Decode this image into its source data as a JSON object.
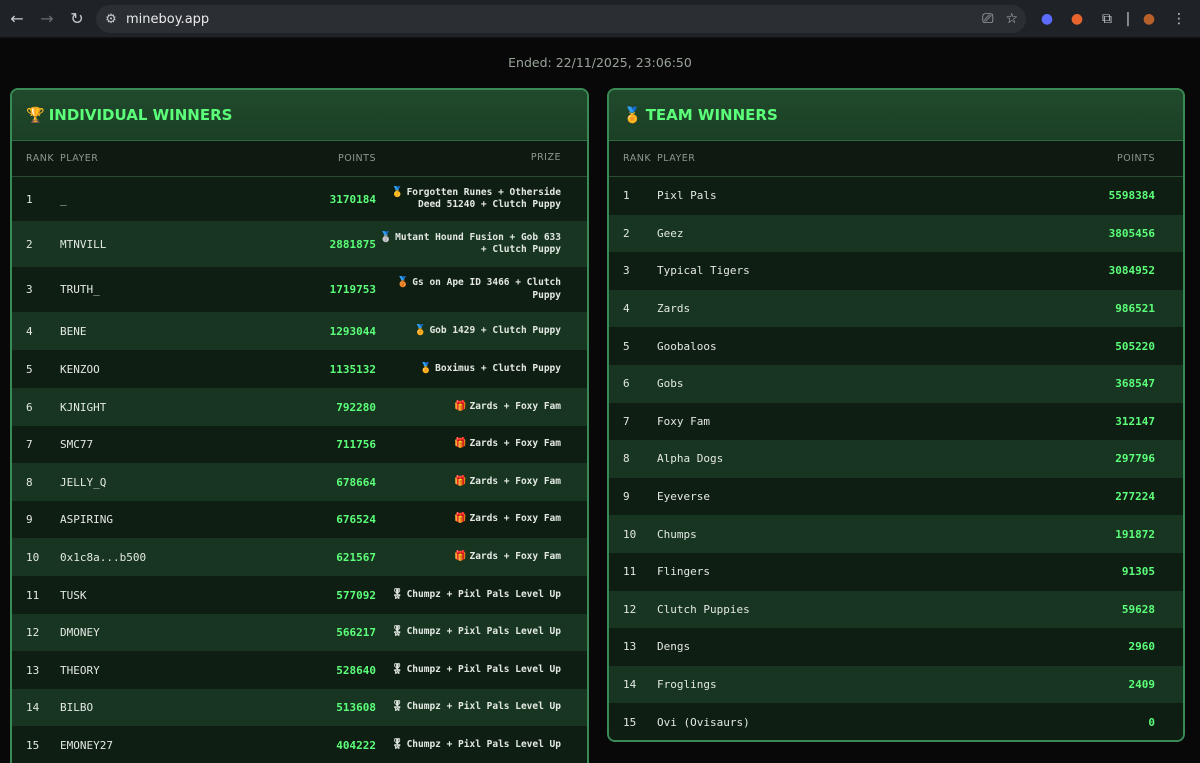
{
  "browser": {
    "url": "mineboy.app"
  },
  "ended_text": "Ended: 22/11/2025, 23:06:50",
  "individual": {
    "title": "INDIVIDUAL WINNERS",
    "title_icon": "🏆",
    "headers": {
      "rank": "RANK",
      "player": "PLAYER",
      "points": "POINTS",
      "prize": "PRIZE"
    },
    "rows": [
      {
        "rank": "1",
        "player": "_",
        "points": "3170184",
        "prize_icon": "🥇",
        "prize": "Forgotten Runes + Otherside Deed 51240 + Clutch Puppy"
      },
      {
        "rank": "2",
        "player": "MTNVILL",
        "points": "2881875",
        "prize_icon": "🥈",
        "prize": "Mutant Hound Fusion + Gob 633 + Clutch Puppy"
      },
      {
        "rank": "3",
        "player": "TRUTH_",
        "points": "1719753",
        "prize_icon": "🥉",
        "prize": "Gs on Ape ID 3466 + Clutch Puppy"
      },
      {
        "rank": "4",
        "player": "BENE",
        "points": "1293044",
        "prize_icon": "🏅",
        "prize": "Gob 1429 + Clutch Puppy"
      },
      {
        "rank": "5",
        "player": "KENZOO",
        "points": "1135132",
        "prize_icon": "🏅",
        "prize": "Boximus + Clutch Puppy"
      },
      {
        "rank": "6",
        "player": "KJNIGHT",
        "points": "792280",
        "prize_icon": "🎁",
        "prize": "Zards + Foxy Fam"
      },
      {
        "rank": "7",
        "player": "SMC77",
        "points": "711756",
        "prize_icon": "🎁",
        "prize": "Zards + Foxy Fam"
      },
      {
        "rank": "8",
        "player": "JELLY_Q",
        "points": "678664",
        "prize_icon": "🎁",
        "prize": "Zards + Foxy Fam"
      },
      {
        "rank": "9",
        "player": "ASPIRING",
        "points": "676524",
        "prize_icon": "🎁",
        "prize": "Zards + Foxy Fam"
      },
      {
        "rank": "10",
        "player": "0x1c8a...b500",
        "points": "621567",
        "prize_icon": "🎁",
        "prize": "Zards + Foxy Fam"
      },
      {
        "rank": "11",
        "player": "TUSK",
        "points": "577092",
        "prize_icon": "🎖",
        "prize": "Chumpz + Pixl Pals Level Up"
      },
      {
        "rank": "12",
        "player": "DMONEY",
        "points": "566217",
        "prize_icon": "🎖",
        "prize": "Chumpz + Pixl Pals Level Up"
      },
      {
        "rank": "13",
        "player": "THEORY",
        "points": "528640",
        "prize_icon": "🎖",
        "prize": "Chumpz + Pixl Pals Level Up"
      },
      {
        "rank": "14",
        "player": "BILBO",
        "points": "513608",
        "prize_icon": "🎖",
        "prize": "Chumpz + Pixl Pals Level Up"
      },
      {
        "rank": "15",
        "player": "EMONEY27",
        "points": "404222",
        "prize_icon": "🎖",
        "prize": "Chumpz + Pixl Pals Level Up"
      }
    ]
  },
  "team": {
    "title": "TEAM WINNERS",
    "title_icon": "🏅",
    "headers": {
      "rank": "RANK",
      "player": "PLAYER",
      "points": "POINTS"
    },
    "rows": [
      {
        "rank": "1",
        "player": "Pixl Pals",
        "points": "5598384"
      },
      {
        "rank": "2",
        "player": "Geez",
        "points": "3805456"
      },
      {
        "rank": "3",
        "player": "Typical Tigers",
        "points": "3084952"
      },
      {
        "rank": "4",
        "player": "Zards",
        "points": "986521"
      },
      {
        "rank": "5",
        "player": "Goobaloos",
        "points": "505220"
      },
      {
        "rank": "6",
        "player": "Gobs",
        "points": "368547"
      },
      {
        "rank": "7",
        "player": "Foxy Fam",
        "points": "312147"
      },
      {
        "rank": "8",
        "player": "Alpha Dogs",
        "points": "297796"
      },
      {
        "rank": "9",
        "player": "Eyeverse",
        "points": "277224"
      },
      {
        "rank": "10",
        "player": "Chumps",
        "points": "191872"
      },
      {
        "rank": "11",
        "player": "Flingers",
        "points": "91305"
      },
      {
        "rank": "12",
        "player": "Clutch Puppies",
        "points": "59628"
      },
      {
        "rank": "13",
        "player": "Dengs",
        "points": "2960"
      },
      {
        "rank": "14",
        "player": "Froglings",
        "points": "2409"
      },
      {
        "rank": "15",
        "player": "Ovi (Ovisaurs)",
        "points": "0"
      }
    ]
  },
  "colors": {
    "accent": "#5cff7a",
    "border": "#3a8a55",
    "header_bg": "#214a2c"
  }
}
